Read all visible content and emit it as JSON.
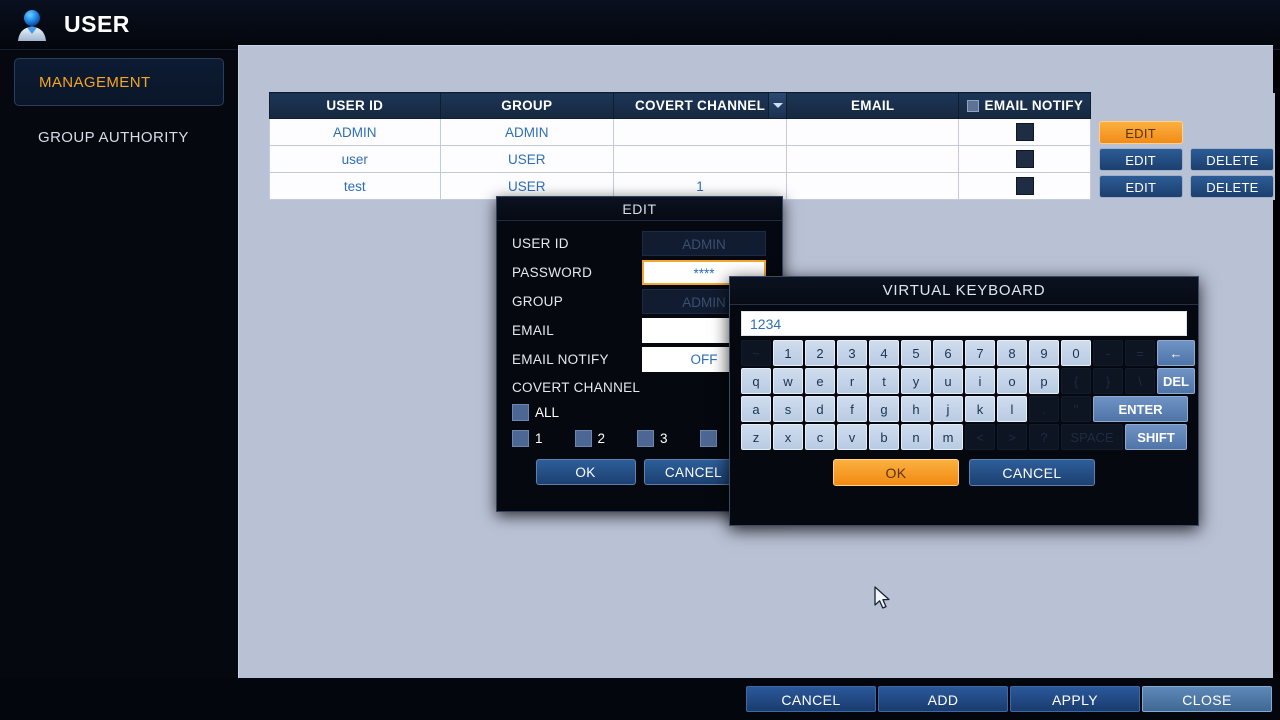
{
  "header": {
    "title": "USER",
    "icon": "user-avatar-icon"
  },
  "sidebar": {
    "items": [
      {
        "label": "MANAGEMENT",
        "active": true
      },
      {
        "label": "GROUP AUTHORITY",
        "active": false
      }
    ]
  },
  "table": {
    "columns": [
      "USER ID",
      "GROUP",
      "COVERT CHANNEL",
      "EMAIL",
      "EMAIL NOTIFY"
    ],
    "covert_has_dropdown": true,
    "notify_header_checkbox": true,
    "rows": [
      {
        "user_id": "ADMIN",
        "group": "ADMIN",
        "covert_channel": "",
        "email": "",
        "email_notify": false,
        "edit_label": "EDIT",
        "edit_active": true,
        "delete_label": ""
      },
      {
        "user_id": "user",
        "group": "USER",
        "covert_channel": "",
        "email": "",
        "email_notify": false,
        "edit_label": "EDIT",
        "edit_active": false,
        "delete_label": "DELETE"
      },
      {
        "user_id": "test",
        "group": "USER",
        "covert_channel": "1",
        "email": "",
        "email_notify": false,
        "edit_label": "EDIT",
        "edit_active": false,
        "delete_label": "DELETE"
      }
    ]
  },
  "edit_dialog": {
    "title": "EDIT",
    "fields": {
      "user_id_label": "USER ID",
      "user_id_value": "ADMIN",
      "password_label": "PASSWORD",
      "password_value": "****",
      "group_label": "GROUP",
      "group_value": "ADMIN",
      "email_label": "EMAIL",
      "email_value": "",
      "email_notify_label": "EMAIL NOTIFY",
      "email_notify_value": "OFF",
      "covert_channel_label": "COVERT CHANNEL"
    },
    "covert_checkboxes": [
      {
        "label": "ALL",
        "checked": false
      },
      {
        "label": "1",
        "checked": false
      },
      {
        "label": "2",
        "checked": false
      },
      {
        "label": "3",
        "checked": false
      },
      {
        "label": "",
        "checked": false
      }
    ],
    "ok_label": "OK",
    "cancel_label": "CANCEL"
  },
  "virtual_keyboard": {
    "title": "VIRTUAL KEYBOARD",
    "input_value": "1234",
    "rows": [
      [
        {
          "label": "~",
          "dim": true
        },
        {
          "label": "1",
          "dim": false
        },
        {
          "label": "2",
          "dim": false
        },
        {
          "label": "3",
          "dim": false
        },
        {
          "label": "4",
          "dim": false
        },
        {
          "label": "5",
          "dim": false
        },
        {
          "label": "6",
          "dim": false
        },
        {
          "label": "7",
          "dim": false
        },
        {
          "label": "8",
          "dim": false
        },
        {
          "label": "9",
          "dim": false
        },
        {
          "label": "0",
          "dim": false
        },
        {
          "label": "-",
          "dim": true
        },
        {
          "label": "=",
          "dim": true
        },
        {
          "label": "←",
          "fn": true,
          "width": "back",
          "name": "backspace-key"
        }
      ],
      [
        {
          "label": "q",
          "dim": false
        },
        {
          "label": "w",
          "dim": false
        },
        {
          "label": "e",
          "dim": false
        },
        {
          "label": "r",
          "dim": false
        },
        {
          "label": "t",
          "dim": false
        },
        {
          "label": "y",
          "dim": false
        },
        {
          "label": "u",
          "dim": false
        },
        {
          "label": "i",
          "dim": false
        },
        {
          "label": "o",
          "dim": false
        },
        {
          "label": "p",
          "dim": false
        },
        {
          "label": "{",
          "dim": true
        },
        {
          "label": "}",
          "dim": true
        },
        {
          "label": "\\",
          "dim": true
        },
        {
          "label": "DEL",
          "fn": true,
          "width": "del",
          "name": "delete-key"
        }
      ],
      [
        {
          "label": "a",
          "dim": false
        },
        {
          "label": "s",
          "dim": false
        },
        {
          "label": "d",
          "dim": false
        },
        {
          "label": "f",
          "dim": false
        },
        {
          "label": "g",
          "dim": false
        },
        {
          "label": "h",
          "dim": false
        },
        {
          "label": "j",
          "dim": false
        },
        {
          "label": "k",
          "dim": false
        },
        {
          "label": "l",
          "dim": false
        },
        {
          "label": ".",
          "dim": true
        },
        {
          "label": "\"",
          "dim": true
        },
        {
          "label": "ENTER",
          "fn": true,
          "width": "enter",
          "name": "enter-key"
        }
      ],
      [
        {
          "label": "z",
          "dim": false
        },
        {
          "label": "x",
          "dim": false
        },
        {
          "label": "c",
          "dim": false
        },
        {
          "label": "v",
          "dim": false
        },
        {
          "label": "b",
          "dim": false
        },
        {
          "label": "n",
          "dim": false
        },
        {
          "label": "m",
          "dim": false
        },
        {
          "label": "<",
          "dim": true
        },
        {
          "label": ">",
          "dim": true
        },
        {
          "label": "?",
          "dim": true
        },
        {
          "label": "SPACE",
          "dim": true,
          "width": "space",
          "name": "space-key"
        },
        {
          "label": "SHIFT",
          "fn": true,
          "width": "shift",
          "name": "shift-key"
        }
      ]
    ],
    "ok_label": "OK",
    "cancel_label": "CANCEL"
  },
  "bottom_bar": {
    "buttons": [
      {
        "label": "CANCEL",
        "hover": false
      },
      {
        "label": "ADD",
        "hover": false
      },
      {
        "label": "APPLY",
        "hover": false
      },
      {
        "label": "CLOSE",
        "hover": true
      }
    ]
  },
  "colors": {
    "accent_orange": "#f5a623",
    "panel_bg": "#b9c1d5",
    "header_navy": "#1d3557",
    "link_blue": "#2d6fb5",
    "dark_bg": "#05080f"
  }
}
